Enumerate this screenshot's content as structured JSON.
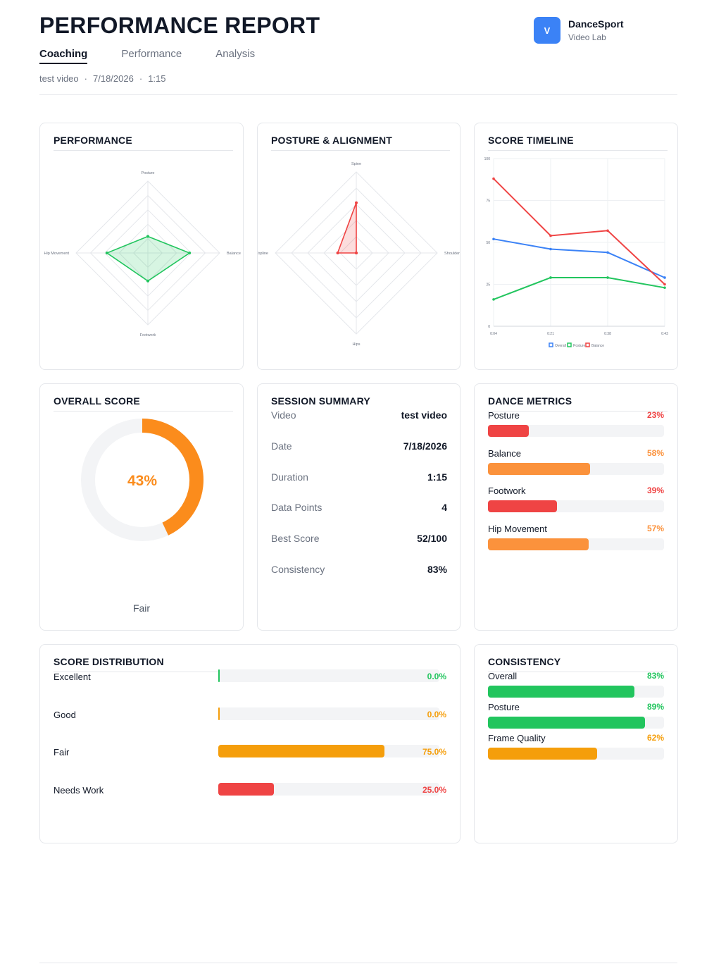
{
  "header": {
    "title": "PERFORMANCE REPORT",
    "tabs": [
      {
        "label": "Coaching",
        "active": true
      },
      {
        "label": "Performance",
        "active": false
      },
      {
        "label": "Analysis",
        "active": false
      }
    ],
    "meta": {
      "video": "test video",
      "date": "7/18/2026",
      "duration": "1:15",
      "separator": "·"
    },
    "brand": {
      "logo_letter": "V",
      "name": "DanceSport",
      "sub": "Video Lab",
      "color": "#3b82f6"
    }
  },
  "cards": {
    "performance": {
      "title": "PERFORMANCE"
    },
    "posture": {
      "title": "POSTURE & ALIGNMENT"
    },
    "timeline": {
      "title": "SCORE TIMELINE"
    },
    "overall": {
      "title": "OVERALL SCORE",
      "value": 43,
      "value_text": "43%",
      "rating": "Fair",
      "color": "#fb8c1c"
    },
    "summary": {
      "title": "SESSION SUMMARY",
      "rows": [
        {
          "label": "Video",
          "value": "test video"
        },
        {
          "label": "Date",
          "value": "7/18/2026"
        },
        {
          "label": "Duration",
          "value": "1:15"
        },
        {
          "label": "Data Points",
          "value": "4"
        },
        {
          "label": "Best Score",
          "value": "52/100"
        },
        {
          "label": "Consistency",
          "value": "83%"
        }
      ]
    },
    "dance_metrics": {
      "title": "DANCE METRICS",
      "items": [
        {
          "label": "Posture",
          "value": 23,
          "pct": "23%",
          "color": "#ef4444"
        },
        {
          "label": "Balance",
          "value": 58,
          "pct": "58%",
          "color": "#fb923c"
        },
        {
          "label": "Footwork",
          "value": 39,
          "pct": "39%",
          "color": "#ef4444"
        },
        {
          "label": "Hip Movement",
          "value": 57,
          "pct": "57%",
          "color": "#fb923c"
        }
      ]
    },
    "distribution": {
      "title": "SCORE DISTRIBUTION",
      "items": [
        {
          "label": "Excellent",
          "value": 0.0,
          "pct": "0.0%",
          "color": "#22c55e"
        },
        {
          "label": "Good",
          "value": 0.0,
          "pct": "0.0%",
          "color": "#f59e0b"
        },
        {
          "label": "Fair",
          "value": 75.0,
          "pct": "75.0%",
          "color": "#f59e0b"
        },
        {
          "label": "Needs Work",
          "value": 25.0,
          "pct": "25.0%",
          "color": "#ef4444"
        }
      ]
    },
    "consistency": {
      "title": "CONSISTENCY",
      "items": [
        {
          "label": "Overall",
          "value": 83,
          "pct": "83%",
          "color": "#22c55e"
        },
        {
          "label": "Posture",
          "value": 89,
          "pct": "89%",
          "color": "#22c55e"
        },
        {
          "label": "Frame Quality",
          "value": 62,
          "pct": "62%",
          "color": "#f59e0b"
        }
      ]
    }
  },
  "chart_data": [
    {
      "type": "radar",
      "axes": [
        "Posture",
        "Balance",
        "Footwork",
        "Hip Movement"
      ],
      "values": [
        23,
        58,
        39,
        57
      ],
      "max": 100,
      "color": "#22c55e"
    },
    {
      "type": "radar",
      "axes": [
        "Spine",
        "Shoulders",
        "Hips",
        "Topline"
      ],
      "values": [
        62,
        0,
        0,
        23
      ],
      "max": 100,
      "color": "#ef4444"
    },
    {
      "type": "line",
      "x": [
        "0:04",
        "0:21",
        "0:38",
        "0:43"
      ],
      "ylim": [
        0,
        100
      ],
      "yticks": [
        0,
        25,
        50,
        75,
        100
      ],
      "series": [
        {
          "name": "Overall",
          "values": [
            52,
            46,
            44,
            29
          ],
          "color": "#3b82f6"
        },
        {
          "name": "Posture",
          "values": [
            16,
            29,
            29,
            23
          ],
          "color": "#22c55e"
        },
        {
          "name": "Balance",
          "values": [
            88,
            54,
            57,
            25
          ],
          "color": "#ef4444"
        }
      ],
      "legend": "bottom"
    }
  ]
}
